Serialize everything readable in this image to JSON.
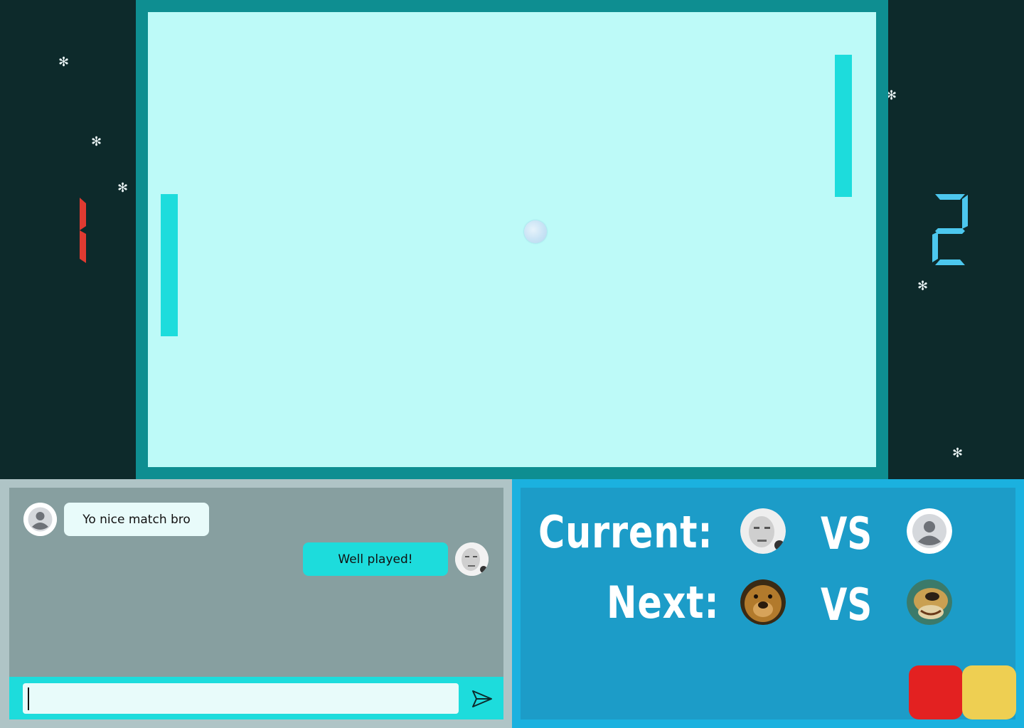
{
  "game": {
    "score_left": "1",
    "score_right": "2",
    "colors": {
      "court": "#bdfaf8",
      "frame": "#0e8e91",
      "paddle": "#1ddcdc",
      "score_left": "#e03a31",
      "score_right": "#4cc7ee",
      "background": "#0d2a2b"
    }
  },
  "chat": {
    "messages": [
      {
        "text": "Yo nice match bro",
        "side": "left",
        "avatar": "default-user-avatar"
      },
      {
        "text": "Well played!",
        "side": "right",
        "avatar": "player-photo-avatar"
      }
    ],
    "input_value": "",
    "send_icon": "send-icon"
  },
  "match": {
    "current_label": "Current:",
    "next_label": "Next:",
    "vs_label": "VS",
    "current_players": [
      "player-photo-avatar",
      "default-user-avatar"
    ],
    "next_players": [
      "bear-avatar",
      "bear-avatar"
    ],
    "color_options": [
      "#e32121",
      "#eecf52"
    ]
  }
}
